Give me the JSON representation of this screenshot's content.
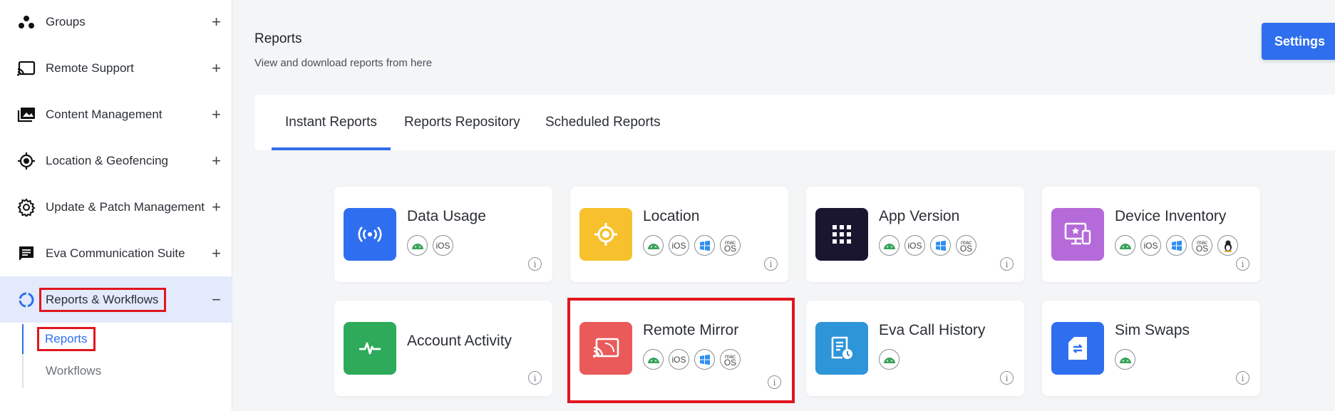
{
  "sidebar": {
    "items": [
      {
        "label": "Groups",
        "icon": "groups-icon"
      },
      {
        "label": "Remote Support",
        "icon": "cast-icon"
      },
      {
        "label": "Content Management",
        "icon": "gallery-icon"
      },
      {
        "label": "Location & Geofencing",
        "icon": "location-target-icon"
      },
      {
        "label": "Update & Patch Management",
        "icon": "gear-icon"
      },
      {
        "label": "Eva Communication Suite",
        "icon": "chat-icon"
      },
      {
        "label": "Reports & Workflows",
        "icon": "reports-ring-icon"
      }
    ],
    "expand_symbol": "+",
    "collapse_symbol": "−",
    "sub_items": [
      "Reports",
      "Workflows"
    ]
  },
  "header": {
    "title": "Reports",
    "subtitle": "View and download reports from here",
    "settings_label": "Settings"
  },
  "tabs": [
    "Instant Reports",
    "Reports Repository",
    "Scheduled Reports"
  ],
  "platform_labels": {
    "ios": "iOS",
    "mac_top": "mac",
    "mac_bottom": "OS",
    "info": "i"
  },
  "colors": {
    "accent": "#2f6fef",
    "highlight": "#e0161e",
    "data_usage": "#2f6fef",
    "location": "#f6c12c",
    "app_version": "#1a1630",
    "device_inventory": "#b56ad9",
    "account_activity": "#2daa5a",
    "remote_mirror": "#ea5a5a",
    "eva_call_history": "#2e95d8",
    "sim_swaps": "#2f6fef"
  },
  "cards": [
    {
      "name": "Data Usage",
      "platforms": [
        "android",
        "ios"
      ]
    },
    {
      "name": "Location",
      "platforms": [
        "android",
        "ios",
        "windows",
        "macos"
      ]
    },
    {
      "name": "App Version",
      "platforms": [
        "android",
        "ios",
        "windows",
        "macos"
      ]
    },
    {
      "name": "Device Inventory",
      "platforms": [
        "android",
        "ios",
        "windows",
        "macos",
        "linux"
      ]
    },
    {
      "name": "Account Activity",
      "platforms": []
    },
    {
      "name": "Remote Mirror",
      "platforms": [
        "android",
        "ios",
        "windows",
        "macos"
      ]
    },
    {
      "name": "Eva Call History",
      "platforms": [
        "android"
      ]
    },
    {
      "name": "Sim Swaps",
      "platforms": [
        "android"
      ]
    }
  ]
}
